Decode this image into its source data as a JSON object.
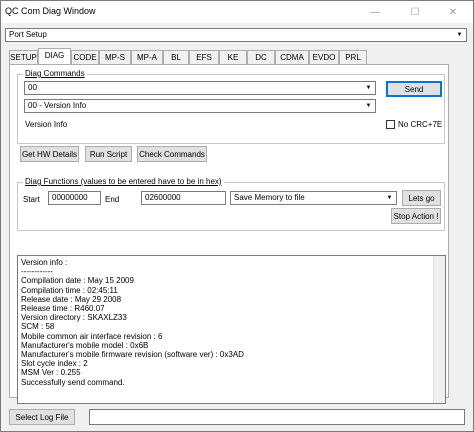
{
  "window": {
    "title": "QC Com Diag Window",
    "minimize": "—",
    "maximize": "☐",
    "close": "✕"
  },
  "port_setup": {
    "value": "Port Setup"
  },
  "tabs": [
    {
      "label": "SETUP"
    },
    {
      "label": "DIAG"
    },
    {
      "label": "CODE"
    },
    {
      "label": "MP-S"
    },
    {
      "label": "MP-A"
    },
    {
      "label": "BL"
    },
    {
      "label": "EFS"
    },
    {
      "label": "KE"
    },
    {
      "label": "DC"
    },
    {
      "label": "CDMA"
    },
    {
      "label": "EVDO"
    },
    {
      "label": "PRL"
    }
  ],
  "active_tab": "DIAG",
  "diag_commands": {
    "group_label": "Diag Commands",
    "command_value": "00",
    "selected_command": "00 - Version Info",
    "description": "Version Info",
    "send_label": "Send",
    "no_crc_label": "No CRC+7E"
  },
  "actions": {
    "get_hw_details": "Get HW Details",
    "run_script": "Run Script",
    "check_commands": "Check Commands"
  },
  "diag_functions": {
    "group_label": "Diag Functions (values to be entered have to be in hex)",
    "start_label": "Start",
    "start_value": "00000000",
    "end_label": "End",
    "end_value": "02600000",
    "function_value": "Save Memory to file",
    "lets_go_label": "Lets go",
    "stop_action_label": "Stop Action !"
  },
  "output_lines": [
    "Version info :",
    "------------",
    "Compilation date : May 15 2009",
    "Compilation time : 02:45:11",
    "Release date : May 29 2008",
    "Release time : R460.07",
    "Version directory : SKAXLZ33",
    "SCM : 58",
    "Mobile common air interface revision : 6",
    "Manufacturer's mobile model : 0x6B",
    "Manufacturer's mobile firmware revision (software ver) : 0x3AD",
    "Slot cycle index : 2",
    "MSM Ver : 0.255",
    "",
    "Successfully send command."
  ],
  "footer": {
    "select_log_label": "Select Log File",
    "log_path": ""
  }
}
